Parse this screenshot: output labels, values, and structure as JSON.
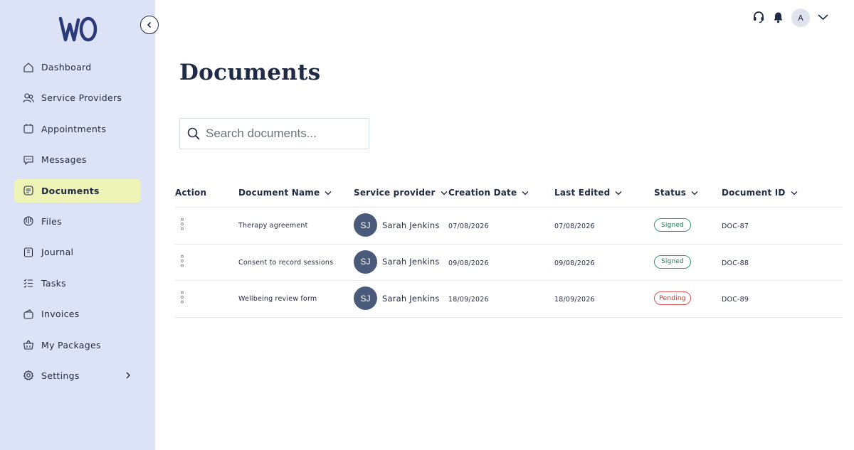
{
  "sidebar": {
    "logo_text": "wO",
    "items": [
      {
        "label": "Dashboard",
        "icon": "home-icon",
        "active": false
      },
      {
        "label": "Service Providers",
        "icon": "users-icon",
        "active": false
      },
      {
        "label": "Appointments",
        "icon": "calendar-icon",
        "active": false
      },
      {
        "label": "Messages",
        "icon": "chat-icon",
        "active": false
      },
      {
        "label": "Documents",
        "icon": "document-icon",
        "active": true
      },
      {
        "label": "Files",
        "icon": "files-icon",
        "active": false
      },
      {
        "label": "Journal",
        "icon": "journal-icon",
        "active": false
      },
      {
        "label": "Tasks",
        "icon": "tasks-icon",
        "active": false
      },
      {
        "label": "Invoices",
        "icon": "wallet-icon",
        "active": false
      },
      {
        "label": "My Packages",
        "icon": "basket-icon",
        "active": false
      },
      {
        "label": "Settings",
        "icon": "gear-icon",
        "active": false
      }
    ]
  },
  "topbar": {
    "avatar_initial": "A"
  },
  "main": {
    "title": "Documents",
    "search": {
      "placeholder": "Search documents..."
    },
    "columns": {
      "action": "Action",
      "document_name": "Document Name",
      "service_provider": "Service provider",
      "creation_date": "Creation Date",
      "last_edited": "Last Edited",
      "status": "Status",
      "document_id": "Document ID"
    },
    "rows": [
      {
        "name": "Therapy agreement",
        "provider_initials": "SJ",
        "provider": "Sarah Jenkins",
        "created": "07/08/2026",
        "edited": "07/08/2026",
        "status": "Signed",
        "id": "DOC-87"
      },
      {
        "name": "Consent to record sessions",
        "provider_initials": "SJ",
        "provider": "Sarah Jenkins",
        "created": "09/08/2026",
        "edited": "09/08/2026",
        "status": "Signed",
        "id": "DOC-88"
      },
      {
        "name": "Wellbeing review form",
        "provider_initials": "SJ",
        "provider": "Sarah Jenkins",
        "created": "18/09/2026",
        "edited": "18/09/2026",
        "status": "Pending",
        "id": "DOC-89"
      }
    ]
  },
  "colors": {
    "sidebar_bg": "#dde3f6",
    "active_item_bg": "#eef3b6",
    "text_primary": "#1f2a44",
    "signed": "#2e9d6a",
    "pending": "#d9534f",
    "provider_avatar": "#4a5a7a"
  }
}
